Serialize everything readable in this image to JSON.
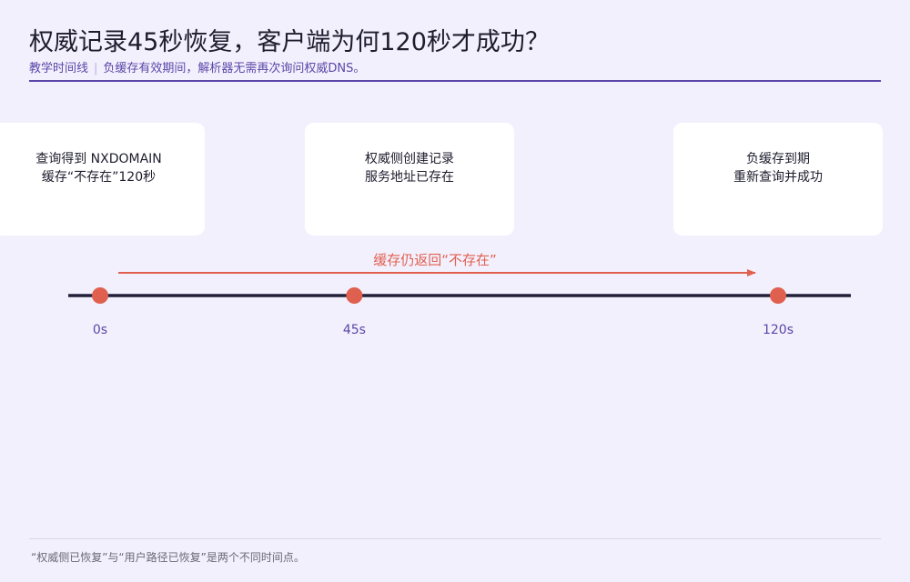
{
  "header": {
    "title": "权威记录45秒恢复，客户端为何120秒才成功？",
    "subtitle_tag": "教学时间线",
    "subtitle_separator": "|",
    "subtitle_text": "负缓存有效期间，解析器无需再次询问权威DNS。"
  },
  "events": [
    {
      "line1": "查询得到 NXDOMAIN",
      "line2": "缓存“不存在”120秒",
      "tick": "0s",
      "t": 0
    },
    {
      "line1": "权威侧创建记录",
      "line2": "服务地址已存在",
      "tick": "45s",
      "t": 45
    },
    {
      "line1": "负缓存到期",
      "line2": "重新查询并成功",
      "tick": "120s",
      "t": 120
    }
  ],
  "arrow": {
    "label": "缓存仍返回“不存在”"
  },
  "colors": {
    "accent": "#5b46a8",
    "marker": "#e0604f",
    "axis": "#22203a",
    "card": "#ffffff",
    "background": "#f3f0fd"
  },
  "footnote": "“权威侧已恢复”与“用户路径已恢复”是两个不同时间点。"
}
